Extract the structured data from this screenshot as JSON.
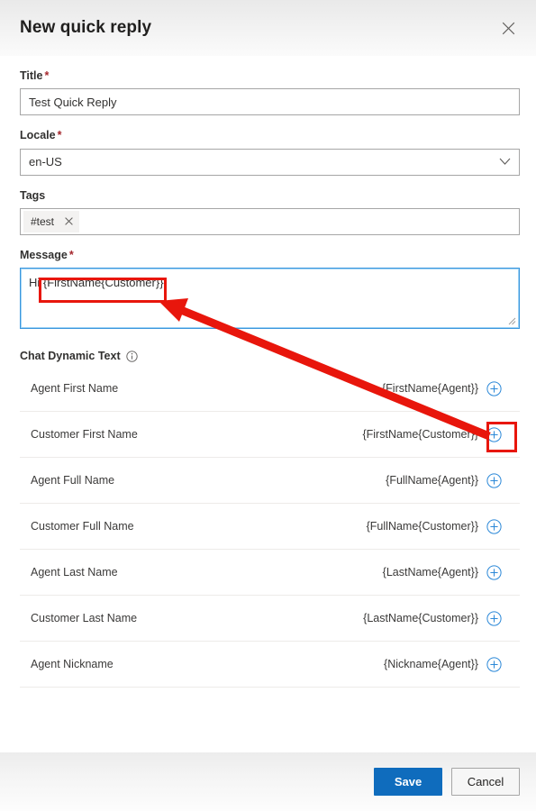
{
  "header": {
    "title": "New quick reply",
    "close_icon": "close-icon"
  },
  "form": {
    "title_field": {
      "label": "Title",
      "required_marker": "*",
      "value": "Test Quick Reply",
      "placeholder": ""
    },
    "locale_field": {
      "label": "Locale",
      "required_marker": "*",
      "value": "en-US",
      "placeholder": "",
      "chevron_icon": "chevron-down-icon"
    },
    "tags_field": {
      "label": "Tags",
      "required_marker": "",
      "tags": [
        {
          "label": "#test",
          "remove_icon": "close-icon"
        }
      ]
    },
    "message_field": {
      "label": "Message",
      "required_marker": "*",
      "value": "Hi {FirstName{Customer}}",
      "placeholder": "",
      "resize_grip_icon": "resize-grip-icon"
    }
  },
  "dynamic_text": {
    "section_title": "Chat Dynamic Text",
    "info_icon": "info-circle-icon",
    "rows": [
      {
        "name": "Agent First Name",
        "token": "{FirstName{Agent}}",
        "add_icon": "plus-circle-icon"
      },
      {
        "name": "Customer First Name",
        "token": "{FirstName{Customer}}",
        "add_icon": "plus-circle-icon"
      },
      {
        "name": "Agent Full Name",
        "token": "{FullName{Agent}}",
        "add_icon": "plus-circle-icon"
      },
      {
        "name": "Customer Full Name",
        "token": "{FullName{Customer}}",
        "add_icon": "plus-circle-icon"
      },
      {
        "name": "Agent Last Name",
        "token": "{LastName{Agent}}",
        "add_icon": "plus-circle-icon"
      },
      {
        "name": "Customer Last Name",
        "token": "{LastName{Customer}}",
        "add_icon": "plus-circle-icon"
      },
      {
        "name": "Agent Nickname",
        "token": "{Nickname{Agent}}",
        "add_icon": "plus-circle-icon"
      }
    ]
  },
  "footer": {
    "save_label": "Save",
    "cancel_label": "Cancel"
  },
  "annotations": {
    "highlight_color": "#e8160c",
    "arrow_icon": "arrow-pointer",
    "boxes": [
      {
        "name": "message-token-highlight"
      },
      {
        "name": "customer-first-name-add-highlight"
      }
    ]
  },
  "colors": {
    "primary_button": "#0f6cbd",
    "focus_border": "#3a96dd",
    "required_asterisk": "#a4262c",
    "annotation_red": "#e8160c"
  }
}
